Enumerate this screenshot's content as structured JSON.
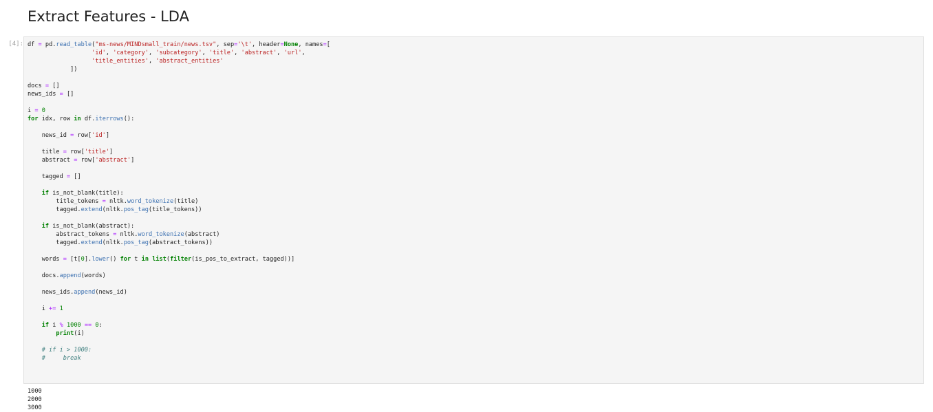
{
  "notebook": {
    "heading": "Extract Features - LDA",
    "cell": {
      "prompt": "[4]:",
      "code_lines": [
        "df = pd.read_table(\"ms-news/MINDsmall_train/news.tsv\", sep='\\t', header=None, names=[",
        "                  'id', 'category', 'subcategory', 'title', 'abstract', 'url',",
        "                  'title_entities', 'abstract_entities'",
        "            ])",
        "",
        "docs = []",
        "news_ids = []",
        "",
        "i = 0",
        "for idx, row in df.iterrows():",
        "",
        "    news_id = row['id']",
        "",
        "    title = row['title']",
        "    abstract = row['abstract']",
        "",
        "    tagged = []",
        "",
        "    if is_not_blank(title):",
        "        title_tokens = nltk.word_tokenize(title)",
        "        tagged.extend(nltk.pos_tag(title_tokens))",
        "",
        "    if is_not_blank(abstract):",
        "        abstract_tokens = nltk.word_tokenize(abstract)",
        "        tagged.extend(nltk.pos_tag(abstract_tokens))",
        "",
        "    words = [t[0].lower() for t in list(filter(is_pos_to_extract, tagged))]",
        "",
        "    docs.append(words)",
        "",
        "    news_ids.append(news_id)",
        "",
        "    i += 1",
        "",
        "    if i % 1000 == 0:",
        "        print(i)",
        "",
        "    # if i > 1000:",
        "    #     break"
      ],
      "output_lines": [
        "1000",
        "2000",
        "3000"
      ]
    }
  }
}
